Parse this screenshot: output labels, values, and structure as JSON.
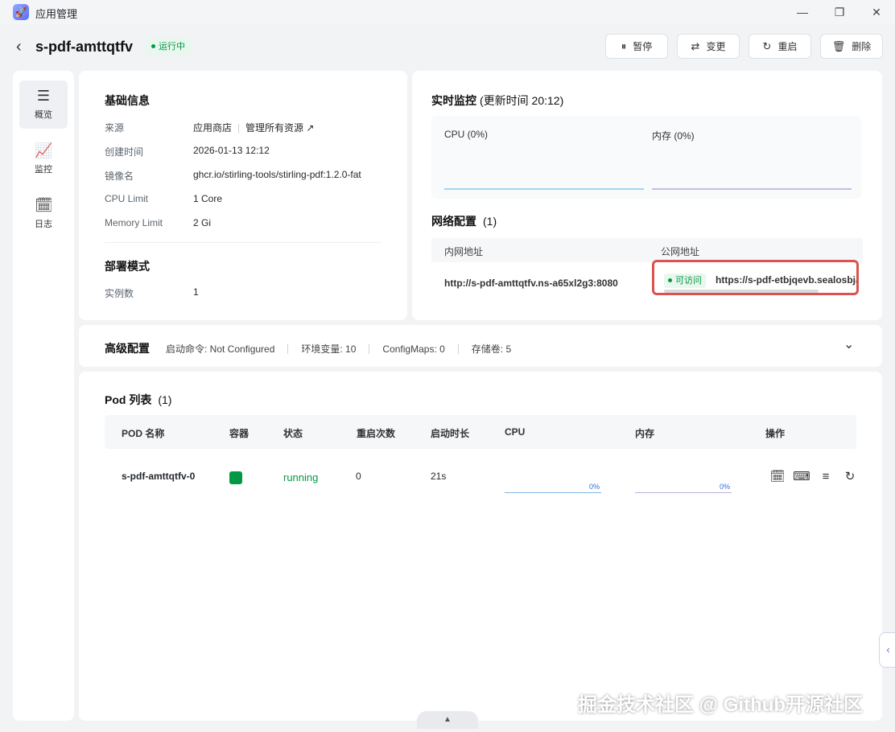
{
  "window": {
    "app_title": "应用管理",
    "controls": {
      "minimize": "—",
      "maximize": "❐",
      "close": "✕"
    }
  },
  "header": {
    "back_icon": "‹",
    "app_name": "s-pdf-amttqtfv",
    "status": "运行中",
    "buttons": {
      "pause": {
        "icon": "⏸",
        "label": "暂停"
      },
      "change": {
        "icon": "⇄",
        "label": "变更"
      },
      "restart": {
        "icon": "↻",
        "label": "重启"
      },
      "delete": {
        "icon": "🗑",
        "label": "删除"
      }
    }
  },
  "sidebar": {
    "items": [
      {
        "icon": "☰",
        "label": "概览"
      },
      {
        "icon": "📈",
        "label": "监控"
      },
      {
        "icon": "🗓",
        "label": "日志"
      }
    ]
  },
  "basic": {
    "title": "基础信息",
    "rows": [
      {
        "label": "来源",
        "value": "应用商店",
        "link": "管理所有资源 ↗"
      },
      {
        "label": "创建时间",
        "value": "2026-01-13 12:12"
      },
      {
        "label": "镜像名",
        "value": "ghcr.io/stirling-tools/stirling-pdf:1.2.0-fat"
      },
      {
        "label": "CPU Limit",
        "value": "1 Core"
      },
      {
        "label": "Memory Limit",
        "value": "2 Gi"
      }
    ],
    "deploy_title": "部署模式",
    "deploy_rows": [
      {
        "label": "实例数",
        "value": "1"
      }
    ]
  },
  "monitor": {
    "title": "实时监控",
    "updated": "(更新时间  20:12)",
    "cpu_label": "CPU  (0%)",
    "mem_label": "内存  (0%)",
    "colors": {
      "cpu": "#a7d3f0",
      "mem": "#c4bfe3"
    }
  },
  "network": {
    "title": "网络配置",
    "count": "(1)",
    "col_inner": "内网地址",
    "col_public": "公网地址",
    "inner": "http://s-pdf-amttqtfv.ns-a65xl2g3:8080",
    "public_status": "可访问",
    "public_url": "https://s-pdf-etbjqevb.sealosbja"
  },
  "advanced": {
    "title": "高级配置",
    "items": [
      "启动命令: Not Configured",
      "环境变量: 10",
      "ConfigMaps: 0",
      "存储卷: 5"
    ],
    "expand_icon": "⌄"
  },
  "pods": {
    "title": "Pod 列表",
    "count": "(1)",
    "columns": [
      "POD 名称",
      "容器",
      "状态",
      "重启次数",
      "启动时长",
      "CPU",
      "内存",
      "操作"
    ],
    "rows": [
      {
        "name": "s-pdf-amttqtfv-0",
        "status": "running",
        "restarts": "0",
        "uptime": "21s",
        "cpu": "0%",
        "mem": "0%"
      }
    ],
    "op_icons": [
      "🗓",
      "⌨",
      "≡",
      "↻"
    ],
    "colors": {
      "container": "#039845",
      "status": "#039845",
      "cpu_bar": "#7fb6e6",
      "mem_bar": "#b9b2db"
    }
  },
  "side_tab_icon": "‹",
  "bottom_icon": "▲",
  "watermark": "掘金技术社区 @ Github开源社区"
}
